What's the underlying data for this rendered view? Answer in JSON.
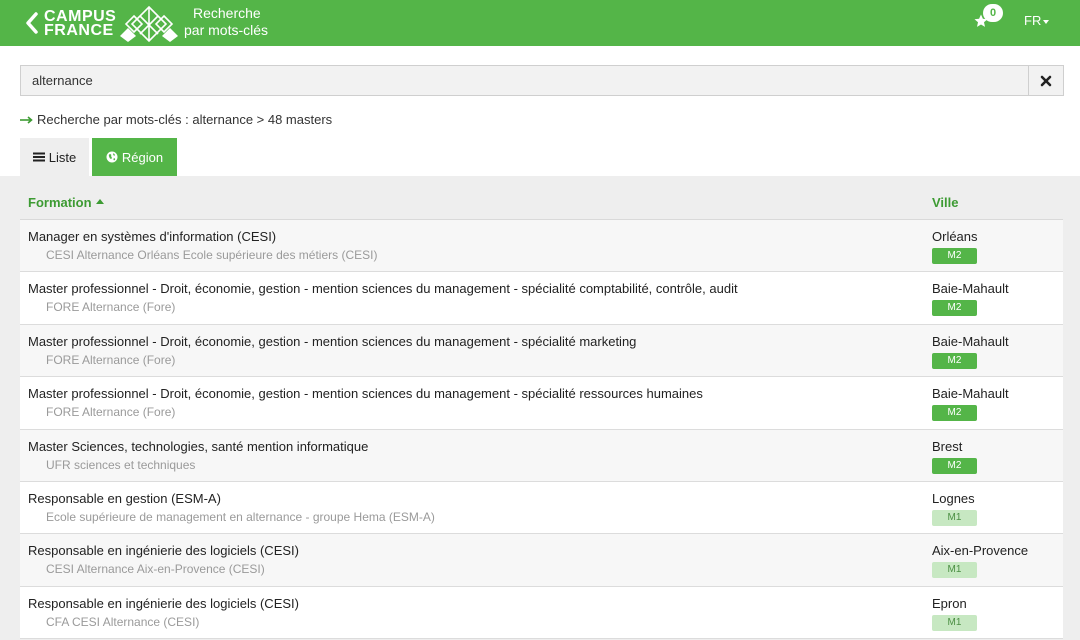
{
  "header": {
    "logo_line1": "CAMPUS",
    "logo_line2": "FRANCE",
    "title_line1": "Recherche",
    "title_line2": "par mots-clés",
    "favorites_count": "0",
    "language": "FR",
    "brand_color": "#54b548"
  },
  "search": {
    "value": "alternance"
  },
  "breadcrumb": {
    "text": "Recherche par mots-clés : alternance > 48 masters"
  },
  "tabs": [
    {
      "label": "Liste",
      "icon": "list-icon",
      "active": false
    },
    {
      "label": "Région",
      "icon": "globe-icon",
      "active": true
    }
  ],
  "table": {
    "columns": {
      "formation": "Formation",
      "ville": "Ville"
    },
    "rows": [
      {
        "title": "Manager en systèmes d'information (CESI)",
        "school": "CESI Alternance Orléans Ecole supérieure des métiers (CESI)",
        "city": "Orléans",
        "level": "M2"
      },
      {
        "title": "Master professionnel - Droit, économie, gestion - mention sciences du management - spécialité comptabilité, contrôle, audit",
        "school": "FORE Alternance (Fore)",
        "city": "Baie-Mahault",
        "level": "M2"
      },
      {
        "title": "Master professionnel - Droit, économie, gestion - mention sciences du management - spécialité marketing",
        "school": "FORE Alternance (Fore)",
        "city": "Baie-Mahault",
        "level": "M2"
      },
      {
        "title": "Master professionnel - Droit, économie, gestion - mention sciences du management - spécialité ressources humaines",
        "school": "FORE Alternance (Fore)",
        "city": "Baie-Mahault",
        "level": "M2"
      },
      {
        "title": "Master Sciences, technologies, santé mention informatique",
        "school": "UFR sciences et techniques",
        "city": "Brest",
        "level": "M2"
      },
      {
        "title": "Responsable en gestion (ESM-A)",
        "school": "Ecole supérieure de management en alternance - groupe Hema (ESM-A)",
        "city": "Lognes",
        "level": "M1"
      },
      {
        "title": "Responsable en ingénierie des logiciels (CESI)",
        "school": "CESI Alternance Aix-en-Provence (CESI)",
        "city": "Aix-en-Provence",
        "level": "M1"
      },
      {
        "title": "Responsable en ingénierie des logiciels (CESI)",
        "school": "CFA CESI Alternance (CESI)",
        "city": "Epron",
        "level": "M1"
      }
    ]
  }
}
